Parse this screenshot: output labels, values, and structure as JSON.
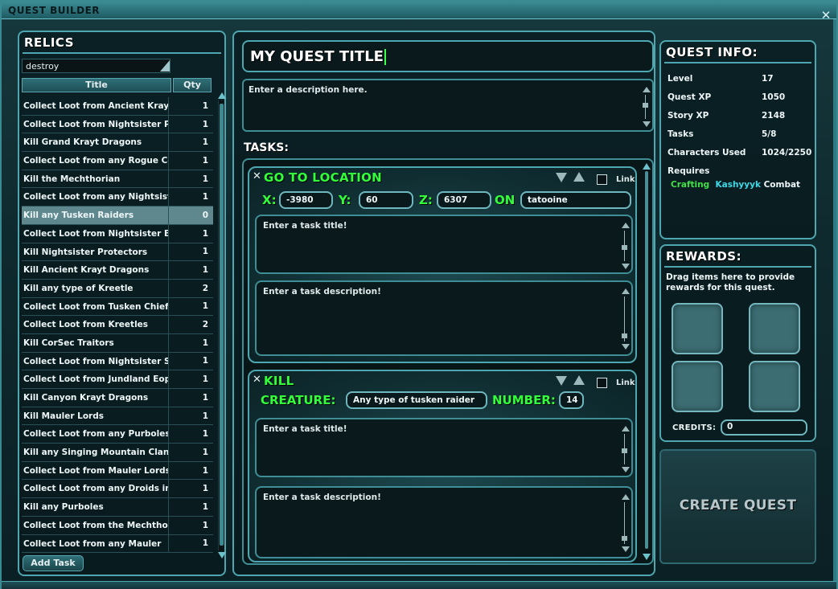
{
  "window": {
    "title": "QUEST BUILDER",
    "close_glyph": "✕"
  },
  "relics": {
    "header": "RELICS",
    "search_value": "destroy",
    "columns": {
      "title": "Title",
      "qty": "Qty"
    },
    "rows": [
      {
        "title": "Collect Loot from Ancient Krayt ...",
        "qty": "1"
      },
      {
        "title": "Collect Loot from Nightsister Pr...",
        "qty": "1"
      },
      {
        "title": "Kill Grand Krayt Dragons",
        "qty": "1"
      },
      {
        "title": "Collect Loot from any Rogue Cor...",
        "qty": "1"
      },
      {
        "title": "Kill the Mechthorian",
        "qty": "1"
      },
      {
        "title": "Collect Loot from any Nightsisters",
        "qty": "1"
      },
      {
        "title": "Kill any Tusken Raiders",
        "qty": "0",
        "selected": true
      },
      {
        "title": "Collect Loot from Nightsister Eld...",
        "qty": "1"
      },
      {
        "title": "Kill Nightsister Protectors",
        "qty": "1"
      },
      {
        "title": "Kill Ancient Krayt Dragons",
        "qty": "1"
      },
      {
        "title": "Kill any type of Kreetle",
        "qty": "2"
      },
      {
        "title": "Collect Loot from Tusken Chiefs",
        "qty": "1"
      },
      {
        "title": "Collect Loot from Kreetles",
        "qty": "2"
      },
      {
        "title": "Kill CorSec Traitors",
        "qty": "1"
      },
      {
        "title": "Collect Loot from Nightsister Se...",
        "qty": "1"
      },
      {
        "title": "Collect Loot from Jundland Eopies",
        "qty": "1"
      },
      {
        "title": "Kill Canyon Krayt Dragons",
        "qty": "1"
      },
      {
        "title": "Kill Mauler Lords",
        "qty": "1"
      },
      {
        "title": "Collect Loot from any Purboles",
        "qty": "1"
      },
      {
        "title": "Kill any Singing Mountain Clan W...",
        "qty": "1"
      },
      {
        "title": "Collect Loot from Mauler Lords",
        "qty": "1"
      },
      {
        "title": "Collect Loot from any Droids in S...",
        "qty": "1"
      },
      {
        "title": "Kill any Purboles",
        "qty": "1"
      },
      {
        "title": "Collect Loot from the Mechthorian",
        "qty": "1"
      },
      {
        "title": "Collect Loot from any Mauler",
        "qty": "1"
      }
    ],
    "add_task": "Add Task"
  },
  "center": {
    "quest_title": "MY QUEST TITLE",
    "description_placeholder": "Enter a description here.",
    "tasks_label": "TASKS:",
    "task1": {
      "close": "✕",
      "type": "GO TO LOCATION",
      "link": "Link",
      "x_label": "X:",
      "x_value": "-3980",
      "y_label": "Y:",
      "y_value": "60",
      "z_label": "Z:",
      "z_value": "6307",
      "on_label": "ON",
      "planet": "tatooine",
      "title_placeholder": "Enter a task title!",
      "desc_placeholder": "Enter a task description!"
    },
    "task2": {
      "close": "✕",
      "type": "KILL",
      "link": "Link",
      "creature_label": "CREATURE:",
      "creature_value": "Any type of tusken  raider",
      "number_label": "NUMBER:",
      "number_value": "14",
      "title_placeholder": "Enter a task title!",
      "desc_placeholder": "Enter a task description!"
    }
  },
  "info": {
    "header": "QUEST INFO:",
    "rows": [
      {
        "k": "Level",
        "v": "17"
      },
      {
        "k": "Quest XP",
        "v": "1050"
      },
      {
        "k": "Story XP",
        "v": "2148"
      },
      {
        "k": "Tasks",
        "v": "5/8"
      },
      {
        "k": "Characters Used",
        "v": "1024/2250"
      }
    ],
    "requires_label": "Requires",
    "requires": {
      "a": "Crafting",
      "b": "Kashyyyk",
      "c": "Combat"
    }
  },
  "rewards": {
    "header": "REWARDS:",
    "text": "Drag items here to provide rewards for this quest.",
    "credits_label": "CREDITS:",
    "credits_value": "0"
  },
  "create_quest": "CREATE QUEST",
  "colors": {
    "accent": "#4ea7b0",
    "green": "#32ff3a",
    "cyan_text": "#40d8e6",
    "selected_row": "#5e888d"
  }
}
